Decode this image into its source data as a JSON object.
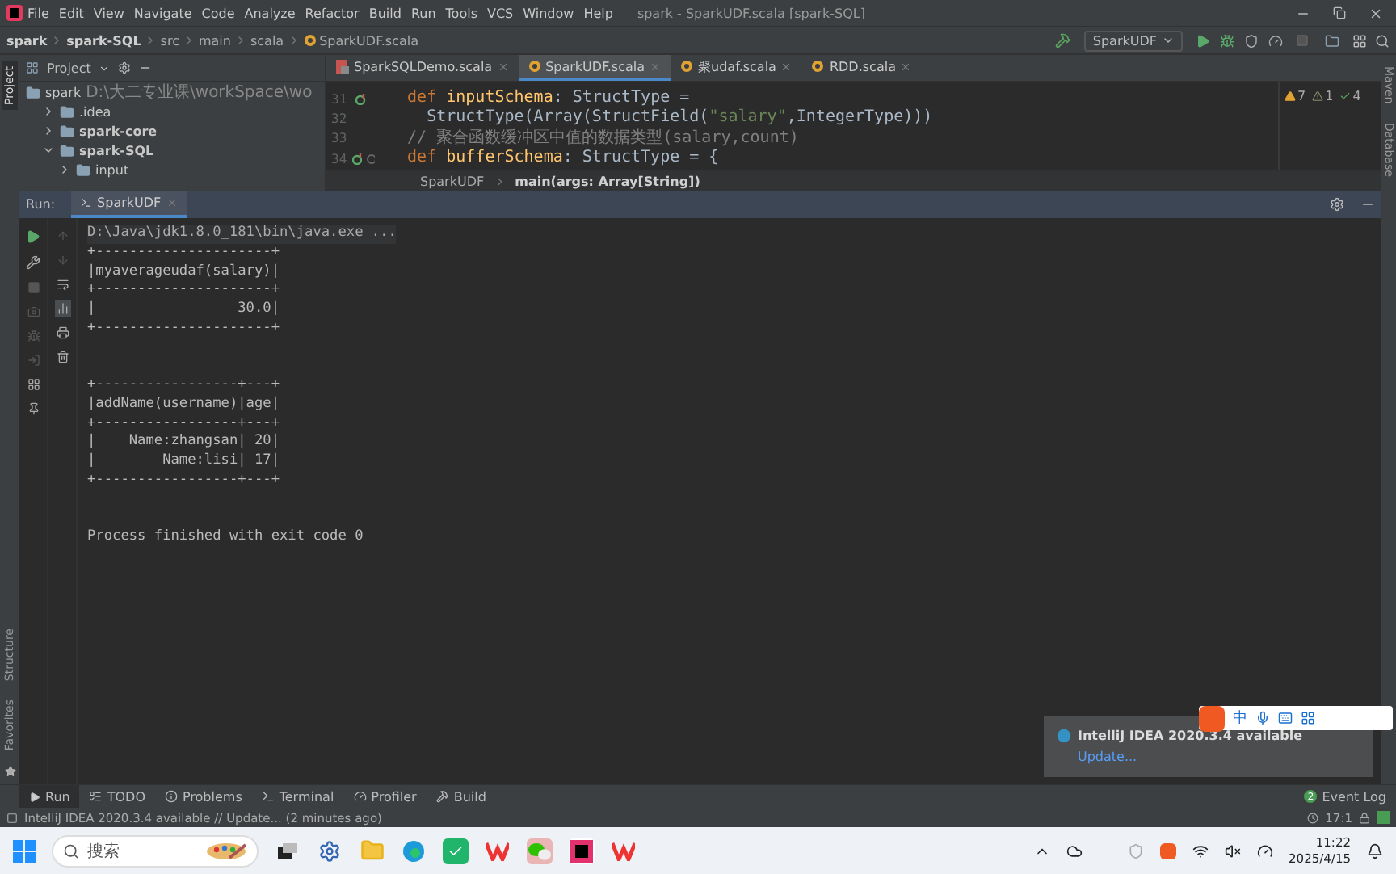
{
  "menu": {
    "items": [
      "File",
      "Edit",
      "View",
      "Navigate",
      "Code",
      "Analyze",
      "Refactor",
      "Build",
      "Run",
      "Tools",
      "VCS",
      "Window",
      "Help"
    ],
    "title": "spark - SparkUDF.scala [spark-SQL]"
  },
  "breadcrumb": [
    "spark",
    "spark-SQL",
    "src",
    "main",
    "scala",
    "SparkUDF.scala"
  ],
  "toolbar": {
    "run_config": "SparkUDF"
  },
  "side_labels": {
    "left_top": "Project",
    "left_bottom": [
      "Structure",
      "Favorites"
    ],
    "right": [
      "Maven",
      "Database"
    ]
  },
  "project_panel": {
    "title": "Project",
    "tree": [
      {
        "name": "spark",
        "path": "D:\\大二专业课\\workSpace\\wo",
        "children": [
          {
            "name": ".idea",
            "expanded": false
          },
          {
            "name": "spark-core",
            "expanded": false
          },
          {
            "name": "spark-SQL",
            "expanded": true,
            "children": [
              {
                "name": "input",
                "expanded": false
              }
            ]
          }
        ]
      }
    ]
  },
  "editor": {
    "tabs": [
      {
        "label": "SparkSQLDemo.scala",
        "kind": "scala-app",
        "selected": false
      },
      {
        "label": "SparkUDF.scala",
        "kind": "scala",
        "selected": true
      },
      {
        "label": "聚udaf.scala",
        "kind": "scala",
        "selected": false
      },
      {
        "label": "RDD.scala",
        "kind": "scala",
        "selected": false
      }
    ],
    "lines": [
      {
        "number": "31",
        "overridden": true,
        "foldable": false,
        "segments": [
          {
            "text": "  def ",
            "kind": "keyword"
          },
          {
            "text": "inputSchema",
            "kind": "function"
          },
          {
            "text": ": StructType =",
            "kind": "plain"
          }
        ]
      },
      {
        "number": "32",
        "overridden": false,
        "foldable": false,
        "segments": [
          {
            "text": "    StructType(Array(StructField(",
            "kind": "plain"
          },
          {
            "text": "\"salary\"",
            "kind": "string"
          },
          {
            "text": ",IntegerType)))",
            "kind": "plain"
          }
        ]
      },
      {
        "number": "33",
        "overridden": false,
        "foldable": false,
        "segments": [
          {
            "text": "  // 聚合函数缓冲区中值的数据类型(salary,count)",
            "kind": "comment"
          }
        ]
      },
      {
        "number": "34",
        "overridden": true,
        "foldable": true,
        "segments": [
          {
            "text": "  def ",
            "kind": "keyword"
          },
          {
            "text": "bufferSchema",
            "kind": "function"
          },
          {
            "text": ": StructType = {",
            "kind": "plain"
          }
        ]
      }
    ],
    "inspections": {
      "warnings": "7",
      "weak_warnings": "1",
      "typos": "4"
    },
    "breadcrumb": [
      "SparkUDF",
      "main(args: Array[String])"
    ]
  },
  "run_panel": {
    "label": "Run:",
    "tab": "SparkUDF",
    "console": {
      "blocks": [
        [
          "D:\\Java\\jdk1.8.0_181\\bin\\java.exe ...",
          "+---------------------+",
          "|myaverageudaf(salary)|",
          "+---------------------+",
          "|                 30.0|",
          "+---------------------+"
        ],
        [
          "+-----------------+---+",
          "|addName(username)|age|",
          "+-----------------+---+",
          "|    Name:zhangsan| 20|",
          "|        Name:lisi| 17|",
          "+-----------------+---+"
        ],
        [
          "Process finished with exit code 0"
        ]
      ]
    }
  },
  "bottom_tabs": [
    {
      "label": "Run",
      "kind": "run",
      "selected": true
    },
    {
      "label": "TODO",
      "kind": "list",
      "selected": false
    },
    {
      "label": "Problems",
      "kind": "info",
      "selected": false
    },
    {
      "label": "Terminal",
      "kind": "terminal",
      "selected": false
    },
    {
      "label": "Profiler",
      "kind": "profiler",
      "selected": false
    },
    {
      "label": "Build",
      "kind": "build",
      "selected": false
    }
  ],
  "event_log": {
    "label": "Event Log",
    "count": "2"
  },
  "status_bar": {
    "message": "IntelliJ IDEA 2020.3.4 available // Update... (2 minutes ago)",
    "position": "17:1"
  },
  "notification": {
    "title": "IntelliJ IDEA 2020.3.4 available",
    "link": "Update..."
  },
  "ime_bar": {
    "mode": "中"
  },
  "taskbar": {
    "search_placeholder": "搜索",
    "time": "11:22",
    "date": "2025/4/15"
  }
}
